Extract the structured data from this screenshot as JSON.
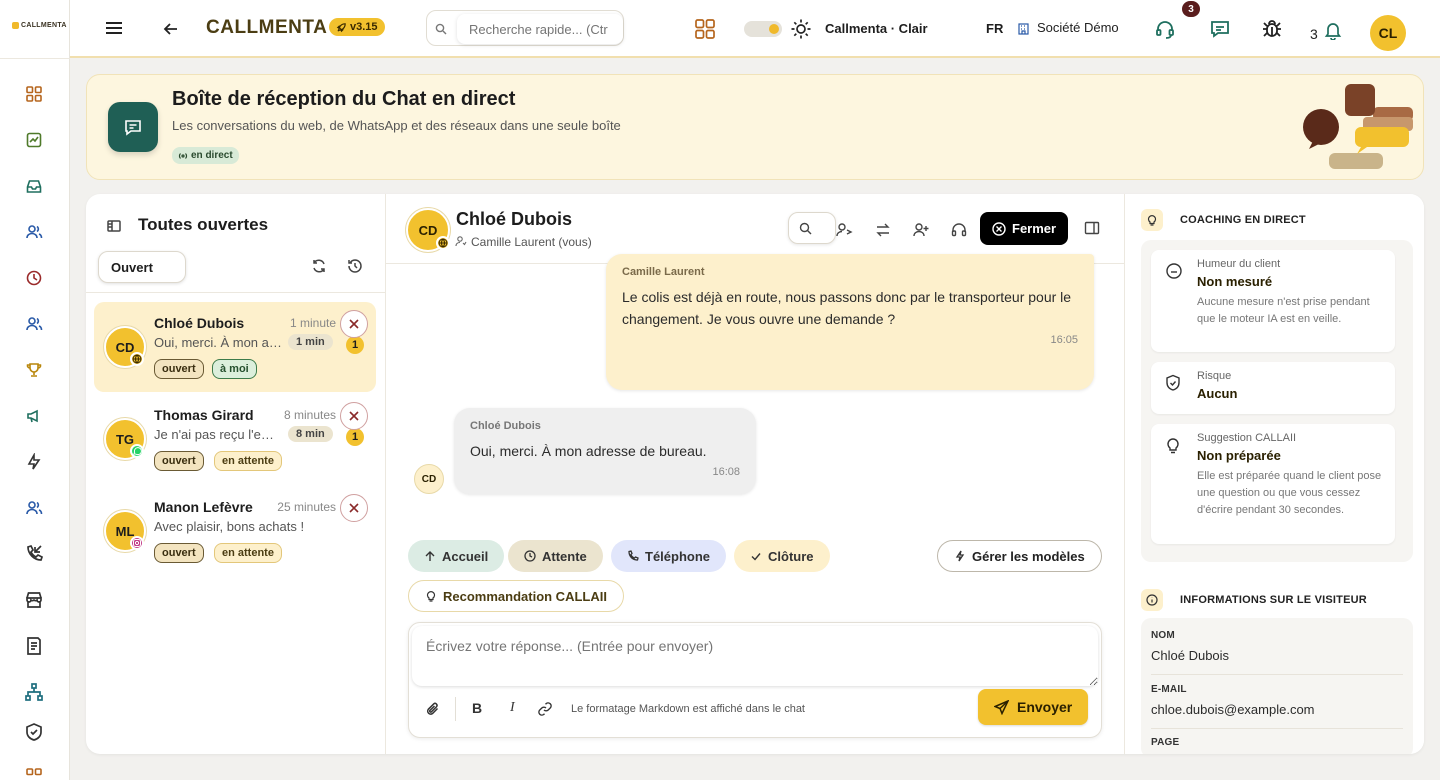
{
  "app": {
    "logo_text": "CALLMENTA",
    "brand": "CALLMENTA",
    "version": "v3.15",
    "search_placeholder": "Recherche rapide... (Ctr",
    "theme_label": "Callmenta · Clair",
    "lang": "FR",
    "company": "Société Démo",
    "support_badge": "3",
    "notif_count": "3",
    "user_initials": "CL",
    "icons": [
      "menu-icon",
      "back-arrow-icon",
      "rocket-icon",
      "search-icon",
      "apps-grid-icon",
      "sun-icon",
      "building-icon",
      "headset-icon",
      "chat-icon",
      "bug-icon",
      "bell-icon"
    ]
  },
  "sidebar": {
    "icons": [
      "dashboard-icon",
      "reports-icon",
      "inbox-icon",
      "contacts-icon",
      "history-icon",
      "team-icon",
      "trophy-icon",
      "campaign-icon",
      "automation-icon",
      "agents-icon",
      "callback-icon",
      "store-icon",
      "invoice-icon",
      "org-chart-icon",
      "security-icon",
      "more-icon"
    ]
  },
  "banner": {
    "title": "Boîte de réception du Chat en direct",
    "subtitle": "Les conversations du web, de WhatsApp et des réseaux dans une seule boîte",
    "live_label": "en direct"
  },
  "list": {
    "title": "Toutes ouvertes",
    "filter_value": "Ouvert",
    "conversations": [
      {
        "initials": "CD",
        "name": "Chloé Dubois",
        "time": "1 minute",
        "preview": "Oui, merci. À mon adresse de bureau.",
        "duration": "1 min",
        "unread": "1",
        "tags": [
          "ouvert",
          "à moi"
        ],
        "channel": "web"
      },
      {
        "initials": "TG",
        "name": "Thomas Girard",
        "time": "8 minutes",
        "preview": "Je n'ai pas reçu l'email",
        "duration": "8 min",
        "unread": "1",
        "tags": [
          "ouvert",
          "en attente"
        ],
        "channel": "whatsapp"
      },
      {
        "initials": "ML",
        "name": "Manon Lefèvre",
        "time": "25 minutes",
        "preview": "Avec plaisir, bons achats !",
        "duration": "",
        "unread": "",
        "tags": [
          "ouvert",
          "en attente"
        ],
        "channel": "instagram"
      }
    ]
  },
  "chat": {
    "contact_initials": "CD",
    "contact_name": "Chloé Dubois",
    "assignee": "Camille Laurent (vous)",
    "close_label": "Fermer",
    "messages": [
      {
        "author": "Camille Laurent",
        "text": "Le colis est déjà en route, nous passons donc par le transporteur pour le changement. Je vous ouvre une demande ?",
        "time": "16:05",
        "side": "agent"
      },
      {
        "author": "Chloé Dubois",
        "text": "Oui, merci. À mon adresse de bureau.",
        "time": "16:08",
        "side": "client"
      }
    ],
    "client_avatar": "CD",
    "quick_replies": [
      "Accueil",
      "Attente",
      "Téléphone",
      "Clôture"
    ],
    "manage_templates": "Gérer les modèles",
    "recommendation": "Recommandation CALLAII",
    "composer_placeholder": "Écrivez votre réponse... (Entrée pour envoyer)",
    "markdown_hint": "Le formatage Markdown est affiché dans le chat",
    "send_label": "Envoyer",
    "bold": "B",
    "italic": "I"
  },
  "coaching": {
    "title": "COACHING EN DIRECT",
    "cards": [
      {
        "label": "Humeur du client",
        "value": "Non mesuré",
        "desc": "Aucune mesure n'est prise pendant que le moteur IA est en veille."
      },
      {
        "label": "Risque",
        "value": "Aucun",
        "desc": ""
      },
      {
        "label": "Suggestion CALLAII",
        "value": "Non préparée",
        "desc": "Elle est préparée quand le client pose une question ou que vous cessez d'écrire pendant 30 secondes."
      }
    ]
  },
  "visitor": {
    "title": "INFORMATIONS SUR LE VISITEUR",
    "fields": [
      {
        "label": "NOM",
        "value": "Chloé Dubois"
      },
      {
        "label": "E-MAIL",
        "value": "chloe.dubois@example.com"
      },
      {
        "label": "PAGE",
        "value": ""
      }
    ]
  },
  "colors": {
    "accent": "#f2c12e",
    "brand_dark": "#4b3d13",
    "teal": "#1f5f55",
    "danger": "#b33a3a"
  }
}
